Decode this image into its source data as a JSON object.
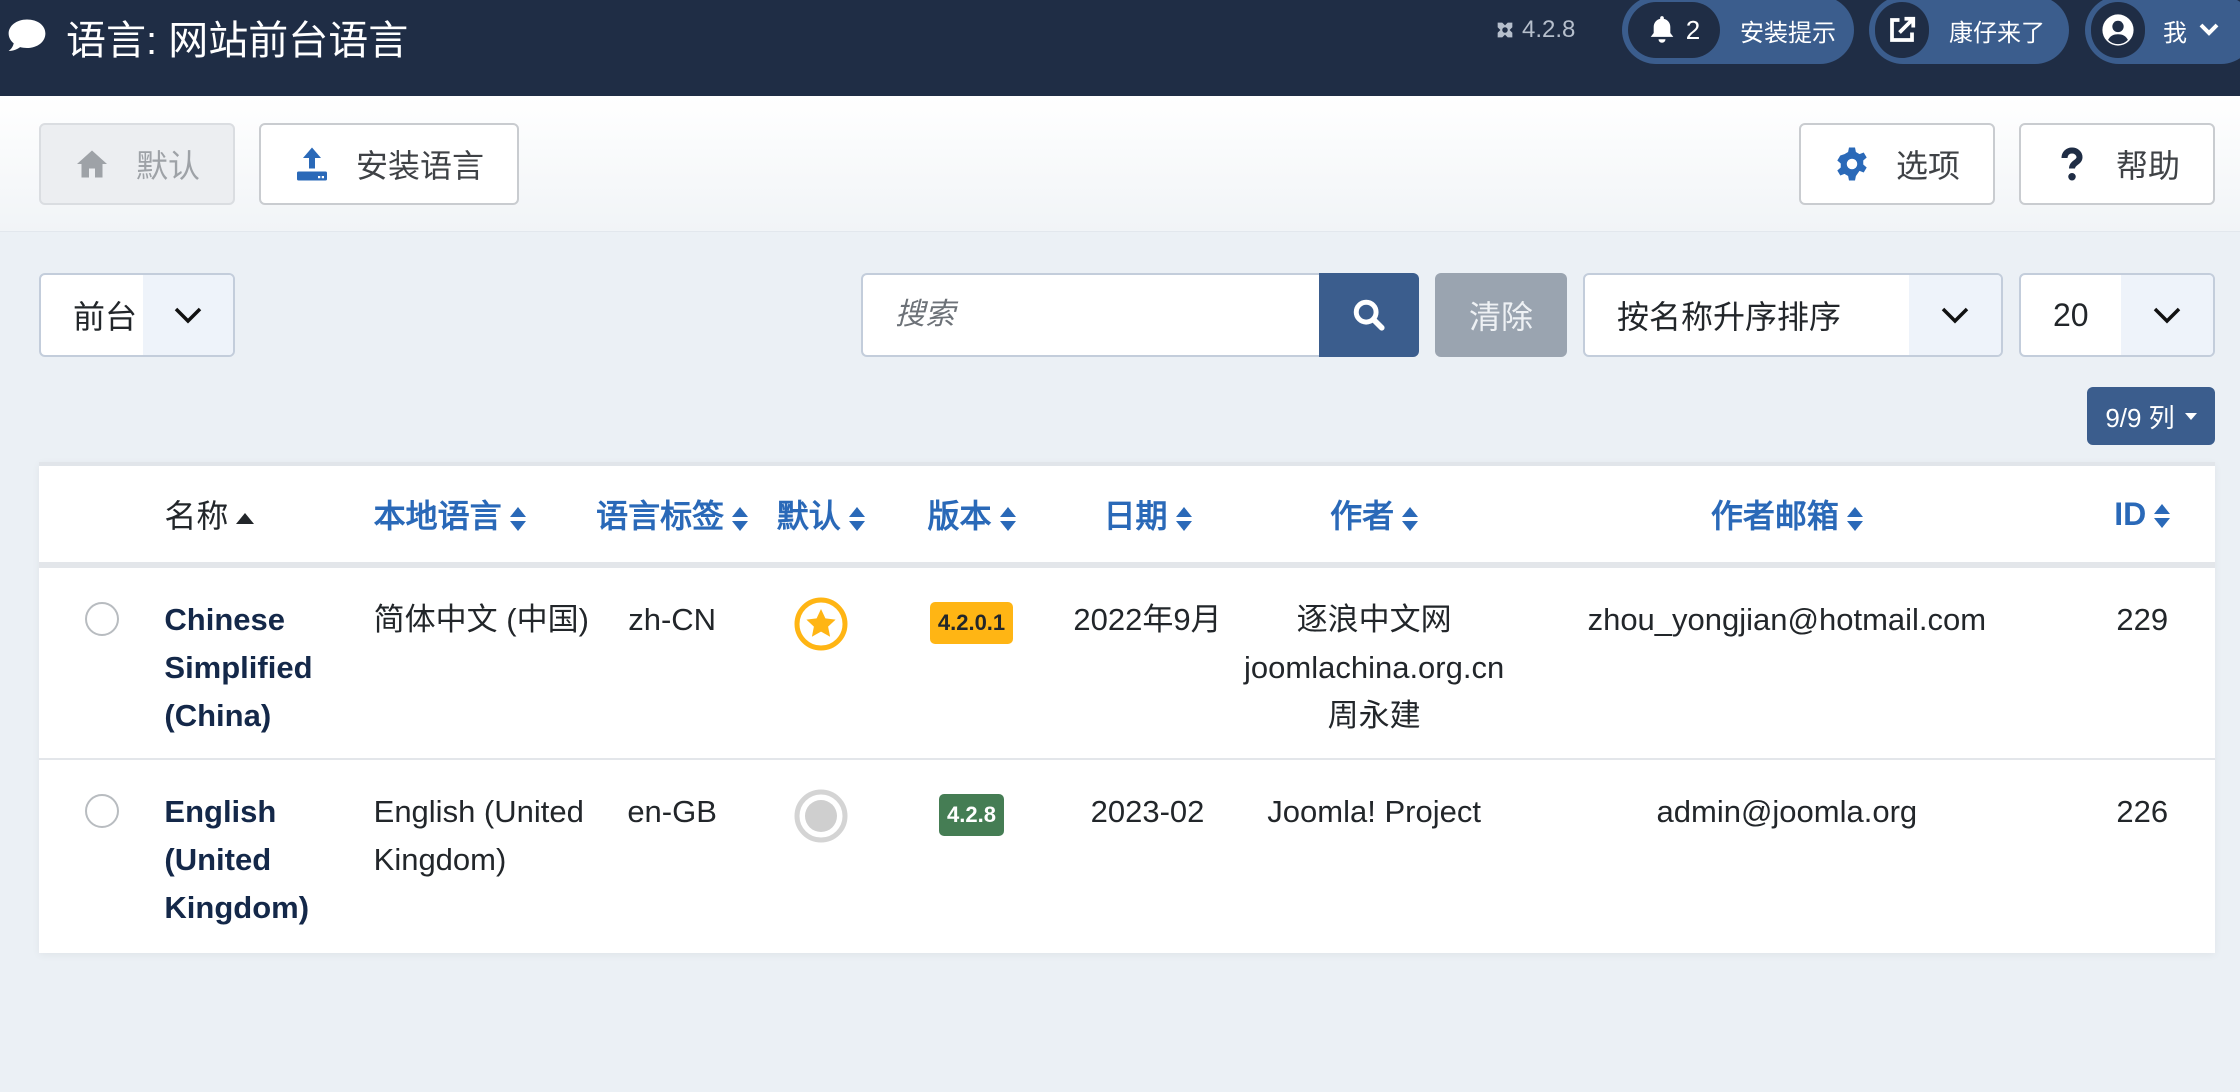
{
  "header": {
    "title": "语言: 网站前台语言",
    "title_icon": "comment-icon",
    "version": "4.2.8",
    "notifications": {
      "count": "2",
      "label": "安装提示"
    },
    "site_link": {
      "label": "康仔来了"
    },
    "user_menu": {
      "label": "我"
    }
  },
  "toolbar": {
    "default_label": "默认",
    "install_label": "安装语言",
    "options_label": "选项",
    "help_label": "帮助"
  },
  "filters": {
    "client": "前台",
    "search_placeholder": "搜索",
    "search_value": "",
    "clear_label": "清除",
    "sort": "按名称升序排序",
    "limit": "20",
    "columns_label": "9/9 列"
  },
  "colors": {
    "header_bg": "#1f2d45",
    "accent": "#3b5d8d",
    "link": "#2a69b8",
    "warning_badge": "#ffb514",
    "success_badge": "#457d54"
  },
  "table": {
    "columns": [
      "名称",
      "本地语言",
      "语言标签",
      "默认",
      "版本",
      "日期",
      "作者",
      "作者邮箱",
      "ID"
    ],
    "sorted_column": "名称",
    "sort_direction": "asc",
    "rows": [
      {
        "name": "Chinese Simplified (China)",
        "native": "简体中文 (中国)",
        "tag": "zh-CN",
        "is_default": true,
        "version": "4.2.0.1",
        "version_status": "warning",
        "date": "2022年9月",
        "author": [
          "逐浪中文网",
          "joomlachina.org.cn",
          "周永建"
        ],
        "email": "zhou_yongjian@hotmail.com",
        "id": "229"
      },
      {
        "name": "English (United Kingdom)",
        "native": "English (United Kingdom)",
        "tag": "en-GB",
        "is_default": false,
        "version": "4.2.8",
        "version_status": "success",
        "date": "2023-02",
        "author": [
          "Joomla! Project"
        ],
        "email": "admin@joomla.org",
        "id": "226"
      }
    ]
  }
}
